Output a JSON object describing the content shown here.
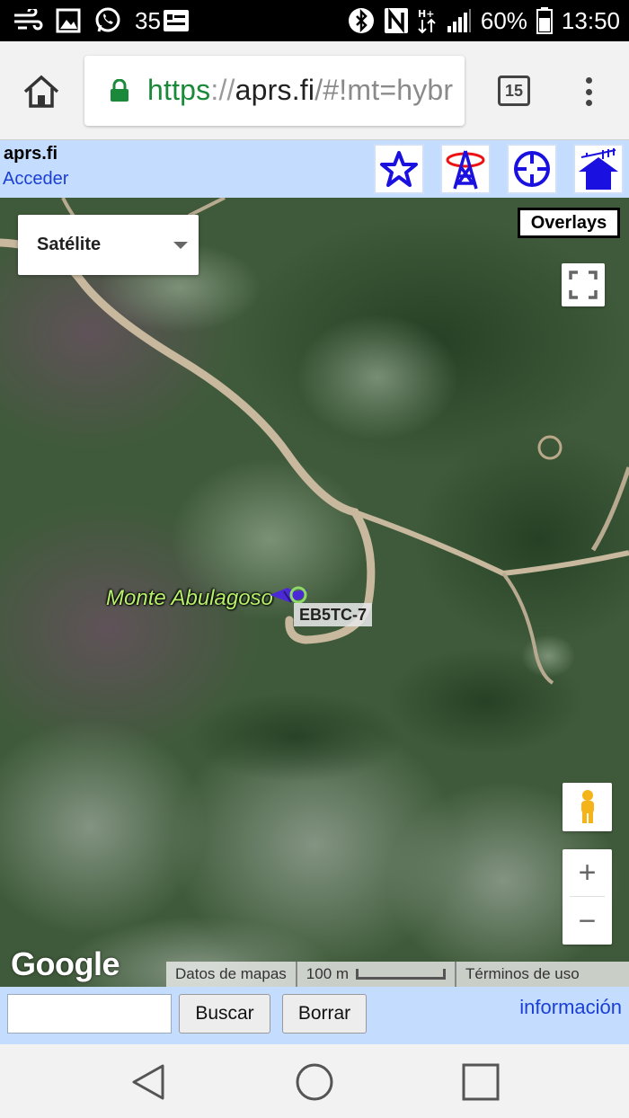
{
  "statusbar": {
    "temperature": "35",
    "battery": "60%",
    "time": "13:50",
    "icons": [
      "wind-icon",
      "image-icon",
      "whatsapp-icon",
      "notes-icon",
      "bluetooth-icon",
      "nfc-icon",
      "hplus-data-icon",
      "signal-icon",
      "battery-icon"
    ]
  },
  "browser": {
    "url_scheme": "https",
    "url_separator": "://",
    "url_host": "aprs.fi",
    "url_path": "/#!mt=hybr",
    "tab_count": "15"
  },
  "header": {
    "site_title": "aprs.fi",
    "login_link": "Acceder",
    "buttons": [
      "star-icon",
      "tower-icon",
      "crosshair-icon",
      "house-antenna-icon"
    ]
  },
  "map": {
    "map_type": "Satélite",
    "overlays_label": "Overlays",
    "place_label": "Monte Abulagoso",
    "station_callsign": "EB5TC-7",
    "logo": "Google",
    "attribution_data": "Datos de mapas",
    "scale_label": "100 m",
    "terms_label": "Términos de uso",
    "zoom_in": "+",
    "zoom_out": "−"
  },
  "search": {
    "input_value": "",
    "search_button": "Buscar",
    "clear_button": "Borrar",
    "info_link": "información"
  },
  "navbar": {
    "icons": [
      "back-icon",
      "home-icon",
      "recents-icon"
    ]
  }
}
